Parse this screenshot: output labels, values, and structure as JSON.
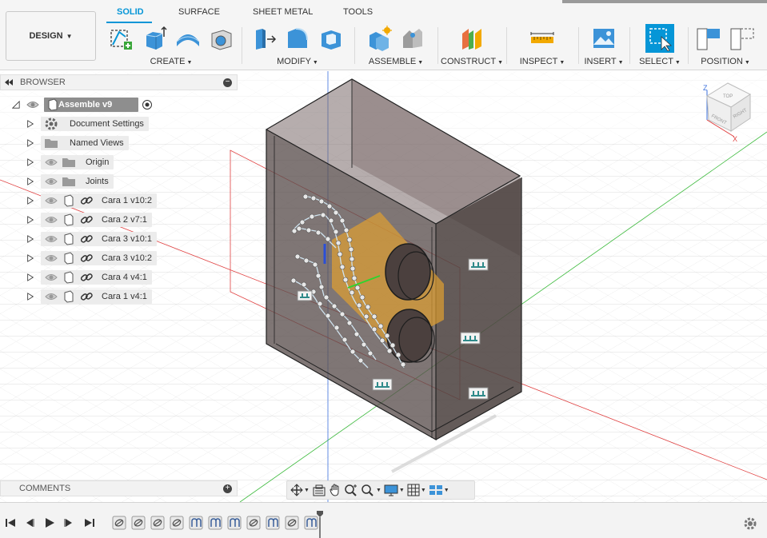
{
  "workspace": {
    "label": "DESIGN",
    "caret": "▼"
  },
  "tabs": [
    {
      "label": "SOLID",
      "active": true
    },
    {
      "label": "SURFACE",
      "active": false
    },
    {
      "label": "SHEET METAL",
      "active": false
    },
    {
      "label": "TOOLS",
      "active": false
    }
  ],
  "groups": {
    "create": "CREATE",
    "modify": "MODIFY",
    "assemble": "ASSEMBLE",
    "construct": "CONSTRUCT",
    "inspect": "INSPECT",
    "insert": "INSERT",
    "select": "SELECT",
    "position": "POSITION"
  },
  "browser": {
    "title": "BROWSER",
    "root": "Assemble v9",
    "items": [
      {
        "label": "Document Settings",
        "icon": "gear-icon"
      },
      {
        "label": "Named Views",
        "icon": "folder-icon"
      },
      {
        "label": "Origin",
        "icon": "folder-icon"
      },
      {
        "label": "Joints",
        "icon": "folder-icon"
      },
      {
        "label": "Cara 1 v10:2",
        "icon": "link-icon"
      },
      {
        "label": "Cara 2 v7:1",
        "icon": "link-icon"
      },
      {
        "label": "Cara 3 v10:1",
        "icon": "link-icon"
      },
      {
        "label": "Cara 3 v10:2",
        "icon": "link-icon"
      },
      {
        "label": "Cara 4 v4:1",
        "icon": "link-icon"
      },
      {
        "label": "Cara 1 v4:1",
        "icon": "link-icon"
      }
    ]
  },
  "comments": {
    "title": "COMMENTS"
  },
  "viewcube": {
    "top": "TOP",
    "front": "FRONT",
    "right": "RIGHT",
    "axis_z": "Z",
    "axis_x": "X"
  },
  "timeline": {
    "features": [
      "joint",
      "joint",
      "joint",
      "joint",
      "rigid",
      "rigid",
      "rigid",
      "joint",
      "rigid",
      "joint",
      "rigid"
    ]
  },
  "colors": {
    "accent": "#0696d7",
    "selection_blue": "#0696d7"
  }
}
